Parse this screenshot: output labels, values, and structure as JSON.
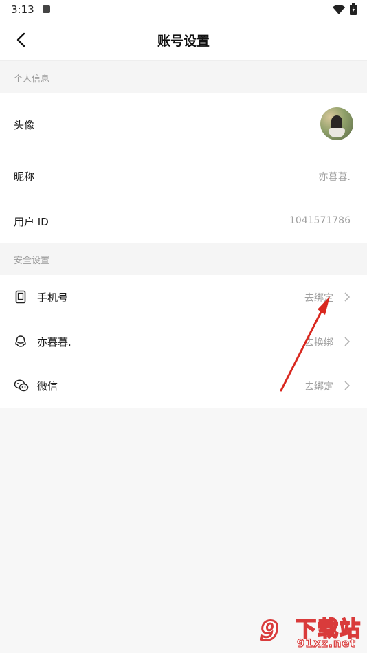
{
  "status_bar": {
    "time": "3:13"
  },
  "header": {
    "title": "账号设置"
  },
  "sections": {
    "personal": {
      "title": "个人信息",
      "avatar_label": "头像",
      "nickname_label": "昵称",
      "nickname_value": "亦暮暮.",
      "user_id_label": "用户 ID",
      "user_id_value": "1041571786"
    },
    "security": {
      "title": "安全设置",
      "phone_label": "手机号",
      "phone_action": "去绑定",
      "qq_label": "亦暮暮.",
      "qq_action": "去换绑",
      "wechat_label": "微信",
      "wechat_action": "去绑定"
    }
  },
  "watermark": {
    "badge": "9",
    "title": "下载站",
    "domain": "91xz.net"
  },
  "colors": {
    "arrow": "#d9281f",
    "watermark": "#d93b3b"
  }
}
